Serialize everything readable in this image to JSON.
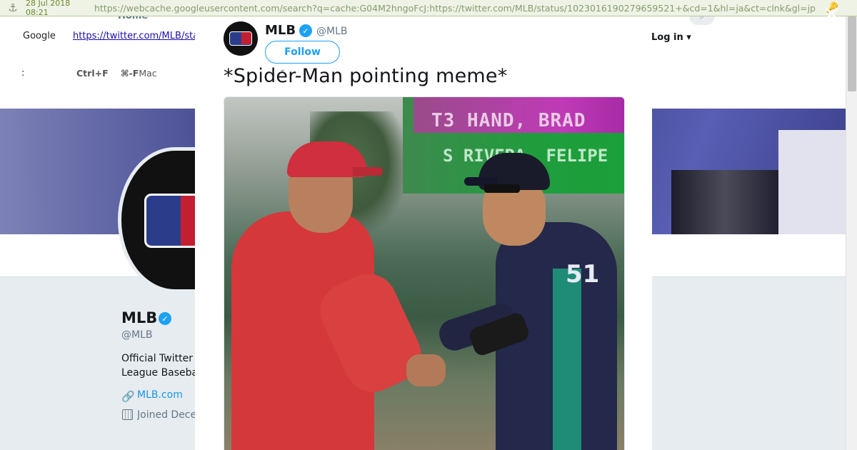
{
  "archive": {
    "date": "28 Jul 2018 08:21",
    "url": "https://webcache.googleusercontent.com/search?q=cache:G04M2hngoFcJ:https://twitter.com/MLB/status/1023016190279659521+&cd=1&hl=ja&ct=clnk&gl=jp"
  },
  "cache_header": {
    "google": "Google",
    "link": "https://twitter.com/MLB/sta",
    "colon": ":",
    "shortcut_ctrl": "Ctrl+F",
    "shortcut_cmd": "⌘-F",
    "mac": "Mac"
  },
  "twitter_nav": {
    "home": "Home",
    "login": "Log in"
  },
  "profile": {
    "name": "MLB",
    "handle": "@MLB",
    "bio_line1": "Official Twitter",
    "bio_line2": "League Baseba",
    "website": "MLB.com",
    "joined": "Joined Dece"
  },
  "tweet": {
    "author_name": "MLB",
    "author_handle": "@MLB",
    "follow_label": "Follow",
    "text": "*Spider-Man pointing meme*",
    "photo": {
      "scoreboard_line1": "T3  HAND, BRAD",
      "scoreboard_line2": "S  RIVERA, FELIPE",
      "jersey_number": "51"
    }
  },
  "icons": {
    "archive": "archive-logo-icon",
    "key": "key-icon",
    "close": "close-icon",
    "verified": "verified-badge-icon",
    "link": "link-icon",
    "calendar": "calendar-icon",
    "search": "search-icon"
  },
  "colors": {
    "twitter_blue": "#1da1f2",
    "archive_bar": "#eef3e6",
    "page_bg": "#e6ecf0"
  }
}
